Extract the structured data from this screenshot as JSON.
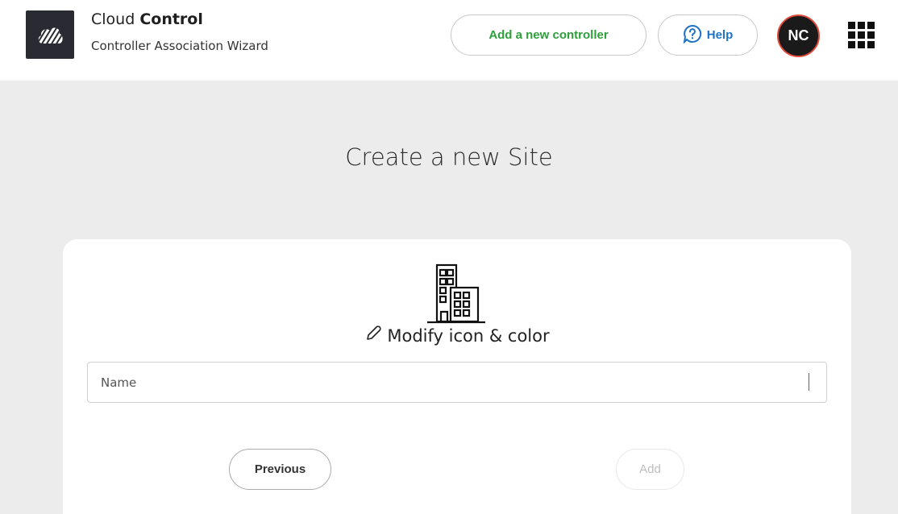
{
  "header": {
    "app_name_light": "Cloud",
    "app_name_bold": "Control",
    "subtitle": "Controller Association Wizard",
    "add_controller_label": "Add a new controller",
    "help_label": "Help",
    "avatar_initials": "NC",
    "logo_icon": "cloud-logo-icon",
    "help_icon": "question-bubble-icon",
    "apps_icon": "apps-grid-icon"
  },
  "main": {
    "title": "Create a new Site",
    "modify_label": "Modify icon & color",
    "modify_icon": "pencil-icon",
    "site_icon": "building-icon",
    "name_input": {
      "placeholder": "Name",
      "value": ""
    },
    "previous_label": "Previous",
    "add_label": "Add"
  },
  "colors": {
    "accent_green": "#2e9f3a",
    "accent_blue": "#1e73c8",
    "avatar_ring": "#e04a3a",
    "background": "#ececec"
  }
}
